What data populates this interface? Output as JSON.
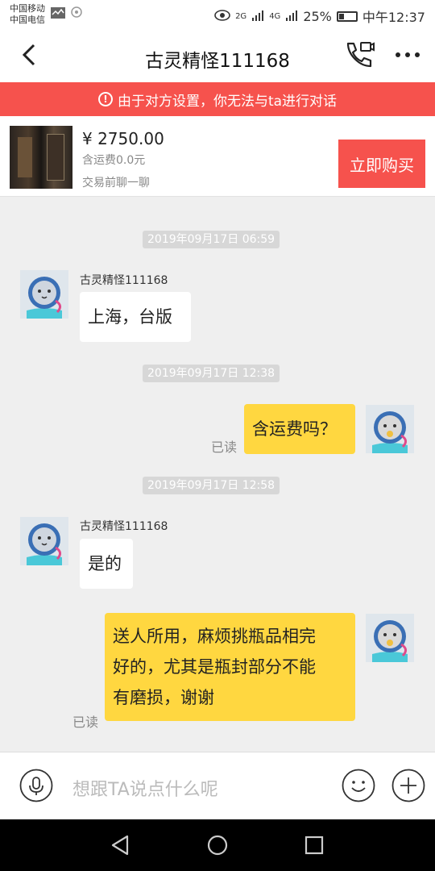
{
  "status_bar": {
    "carrier1": "中国移动",
    "carrier2": "中国电信",
    "net2g": "2G",
    "net4g": "4G",
    "battery": "25%",
    "time": "中午12:37"
  },
  "header": {
    "title": "古灵精怪111168"
  },
  "banner": {
    "text": "由于对方设置，你无法与ta进行对话"
  },
  "product": {
    "price": "¥ 2750.00",
    "shipping": "含运费0.0元",
    "chat_first": "交易前聊一聊",
    "buy_label": "立即购买"
  },
  "messages": [
    {
      "timestamp": "2019年09月17日 06:59",
      "sender": "古灵精怪111168",
      "text": "上海，台版"
    },
    {
      "timestamp": "2019年09月17日 12:38",
      "text": "含运费吗？",
      "status": "已读"
    },
    {
      "timestamp": "2019年09月17日 12:58",
      "sender": "古灵精怪111168",
      "text": "是的"
    },
    {
      "text_lines": [
        "送人所用，麻烦挑瓶品相完",
        "好的，尤其是瓶封部分不能",
        "有磨损，谢谢"
      ],
      "status": "已读"
    }
  ],
  "input": {
    "placeholder": "想跟TA说点什么呢"
  },
  "colors": {
    "accent_red": "#f6524d",
    "own_bubble": "#ffd740",
    "background": "#efefef"
  }
}
